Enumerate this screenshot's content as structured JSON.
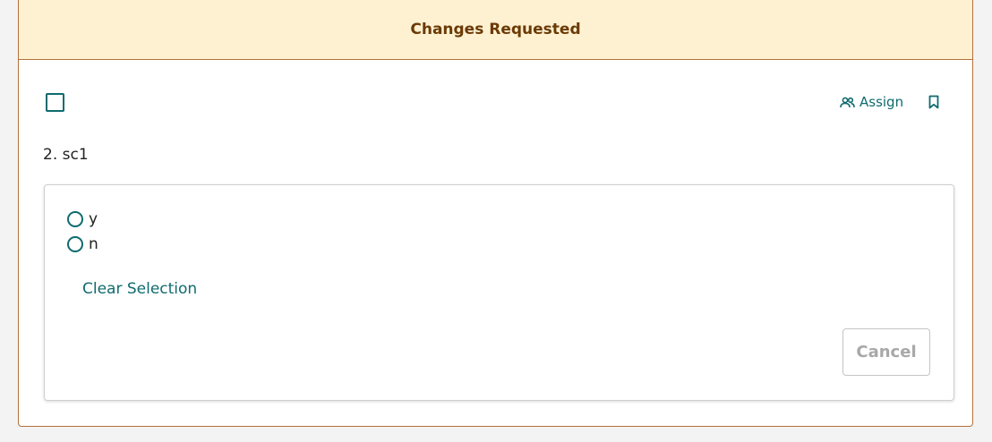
{
  "banner": {
    "status_text": "Changes Requested"
  },
  "toolbar": {
    "assign_label": "Assign"
  },
  "question": {
    "title": "2. sc1",
    "options": [
      {
        "label": "y",
        "selected": false
      },
      {
        "label": "n",
        "selected": false
      }
    ],
    "clear_label": "Clear Selection",
    "cancel_label": "Cancel"
  },
  "icons": {
    "checkbox": "checkbox-icon",
    "assign": "people-icon",
    "bookmark": "bookmark-icon",
    "radio": "radio-icon"
  },
  "colors": {
    "accent": "#0f6b6e",
    "banner_bg": "#fdf1d2",
    "banner_text": "#6b3a05",
    "card_border": "#b5703a"
  }
}
